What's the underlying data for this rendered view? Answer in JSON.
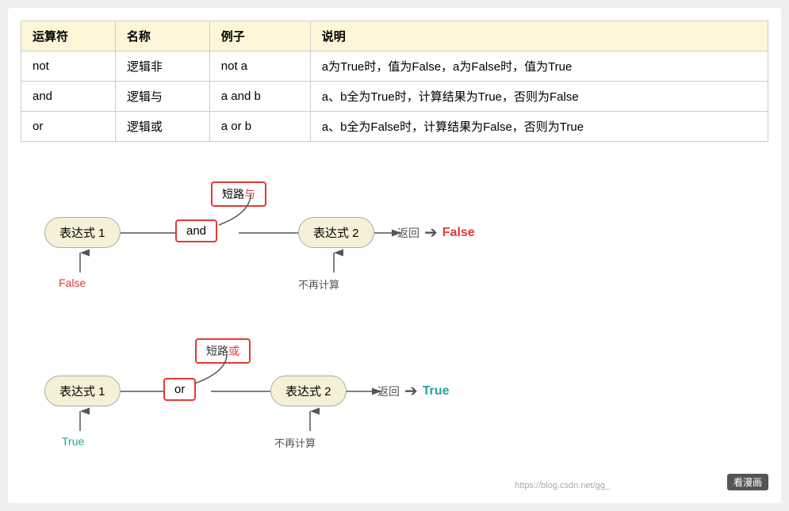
{
  "table": {
    "headers": [
      "运算符",
      "名称",
      "例子",
      "说明"
    ],
    "rows": [
      {
        "operator": "not",
        "name": "逻辑非",
        "example": "not a",
        "description": "a为True时，值为False，a为False时，值为True"
      },
      {
        "operator": "and",
        "name": "逻辑与",
        "example": "a and b",
        "description": "a、b全为True时，计算结果为True，否则为False"
      },
      {
        "operator": "or",
        "name": "逻辑或",
        "example": "a or b",
        "description": "a、b全为False时，计算结果为False，否则为True"
      }
    ]
  },
  "and_diagram": {
    "label": "短路与",
    "expr1": "表达式 1",
    "operator": "and",
    "expr2": "表达式 2",
    "return_label": "返回",
    "result": "False",
    "below_expr1": "False",
    "below_expr2": "不再计算"
  },
  "or_diagram": {
    "label": "短路或",
    "expr1": "表达式 1",
    "operator": "or",
    "expr2": "表达式 2",
    "return_label": "返回",
    "result": "True",
    "below_expr1": "True",
    "below_expr2": "不再计算"
  },
  "watermark": {
    "url": "https://blog.csdn.net/gg_",
    "site": "看漫画"
  }
}
